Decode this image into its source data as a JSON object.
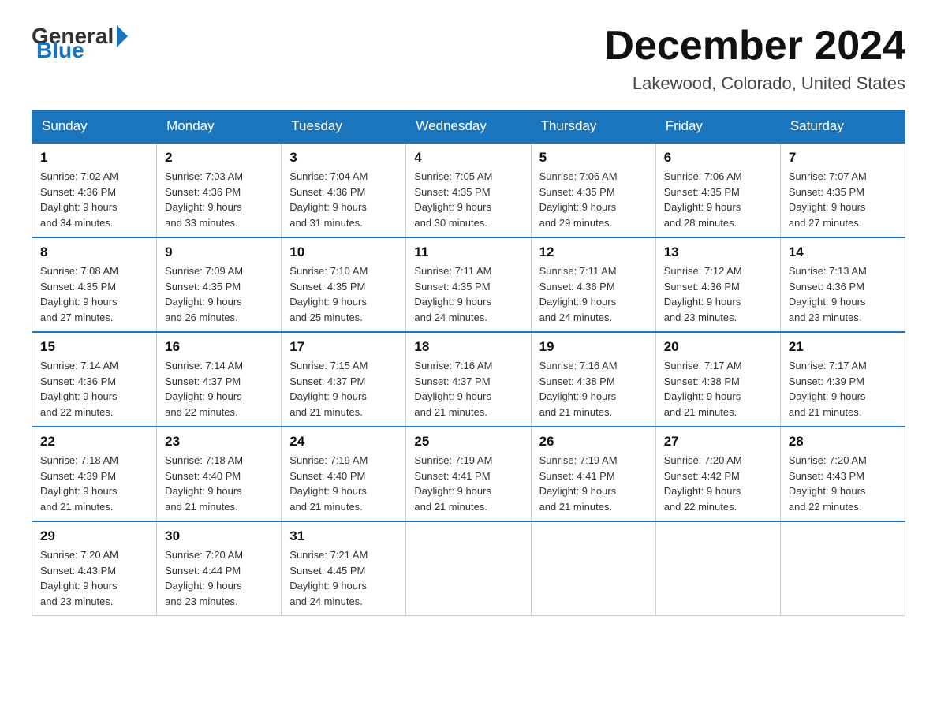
{
  "header": {
    "logo_general": "General",
    "logo_blue": "Blue",
    "month_title": "December 2024",
    "location": "Lakewood, Colorado, United States"
  },
  "weekdays": [
    "Sunday",
    "Monday",
    "Tuesday",
    "Wednesday",
    "Thursday",
    "Friday",
    "Saturday"
  ],
  "weeks": [
    [
      {
        "day": "1",
        "sunrise": "7:02 AM",
        "sunset": "4:36 PM",
        "daylight": "9 hours and 34 minutes."
      },
      {
        "day": "2",
        "sunrise": "7:03 AM",
        "sunset": "4:36 PM",
        "daylight": "9 hours and 33 minutes."
      },
      {
        "day": "3",
        "sunrise": "7:04 AM",
        "sunset": "4:36 PM",
        "daylight": "9 hours and 31 minutes."
      },
      {
        "day": "4",
        "sunrise": "7:05 AM",
        "sunset": "4:35 PM",
        "daylight": "9 hours and 30 minutes."
      },
      {
        "day": "5",
        "sunrise": "7:06 AM",
        "sunset": "4:35 PM",
        "daylight": "9 hours and 29 minutes."
      },
      {
        "day": "6",
        "sunrise": "7:06 AM",
        "sunset": "4:35 PM",
        "daylight": "9 hours and 28 minutes."
      },
      {
        "day": "7",
        "sunrise": "7:07 AM",
        "sunset": "4:35 PM",
        "daylight": "9 hours and 27 minutes."
      }
    ],
    [
      {
        "day": "8",
        "sunrise": "7:08 AM",
        "sunset": "4:35 PM",
        "daylight": "9 hours and 27 minutes."
      },
      {
        "day": "9",
        "sunrise": "7:09 AM",
        "sunset": "4:35 PM",
        "daylight": "9 hours and 26 minutes."
      },
      {
        "day": "10",
        "sunrise": "7:10 AM",
        "sunset": "4:35 PM",
        "daylight": "9 hours and 25 minutes."
      },
      {
        "day": "11",
        "sunrise": "7:11 AM",
        "sunset": "4:35 PM",
        "daylight": "9 hours and 24 minutes."
      },
      {
        "day": "12",
        "sunrise": "7:11 AM",
        "sunset": "4:36 PM",
        "daylight": "9 hours and 24 minutes."
      },
      {
        "day": "13",
        "sunrise": "7:12 AM",
        "sunset": "4:36 PM",
        "daylight": "9 hours and 23 minutes."
      },
      {
        "day": "14",
        "sunrise": "7:13 AM",
        "sunset": "4:36 PM",
        "daylight": "9 hours and 23 minutes."
      }
    ],
    [
      {
        "day": "15",
        "sunrise": "7:14 AM",
        "sunset": "4:36 PM",
        "daylight": "9 hours and 22 minutes."
      },
      {
        "day": "16",
        "sunrise": "7:14 AM",
        "sunset": "4:37 PM",
        "daylight": "9 hours and 22 minutes."
      },
      {
        "day": "17",
        "sunrise": "7:15 AM",
        "sunset": "4:37 PM",
        "daylight": "9 hours and 21 minutes."
      },
      {
        "day": "18",
        "sunrise": "7:16 AM",
        "sunset": "4:37 PM",
        "daylight": "9 hours and 21 minutes."
      },
      {
        "day": "19",
        "sunrise": "7:16 AM",
        "sunset": "4:38 PM",
        "daylight": "9 hours and 21 minutes."
      },
      {
        "day": "20",
        "sunrise": "7:17 AM",
        "sunset": "4:38 PM",
        "daylight": "9 hours and 21 minutes."
      },
      {
        "day": "21",
        "sunrise": "7:17 AM",
        "sunset": "4:39 PM",
        "daylight": "9 hours and 21 minutes."
      }
    ],
    [
      {
        "day": "22",
        "sunrise": "7:18 AM",
        "sunset": "4:39 PM",
        "daylight": "9 hours and 21 minutes."
      },
      {
        "day": "23",
        "sunrise": "7:18 AM",
        "sunset": "4:40 PM",
        "daylight": "9 hours and 21 minutes."
      },
      {
        "day": "24",
        "sunrise": "7:19 AM",
        "sunset": "4:40 PM",
        "daylight": "9 hours and 21 minutes."
      },
      {
        "day": "25",
        "sunrise": "7:19 AM",
        "sunset": "4:41 PM",
        "daylight": "9 hours and 21 minutes."
      },
      {
        "day": "26",
        "sunrise": "7:19 AM",
        "sunset": "4:41 PM",
        "daylight": "9 hours and 21 minutes."
      },
      {
        "day": "27",
        "sunrise": "7:20 AM",
        "sunset": "4:42 PM",
        "daylight": "9 hours and 22 minutes."
      },
      {
        "day": "28",
        "sunrise": "7:20 AM",
        "sunset": "4:43 PM",
        "daylight": "9 hours and 22 minutes."
      }
    ],
    [
      {
        "day": "29",
        "sunrise": "7:20 AM",
        "sunset": "4:43 PM",
        "daylight": "9 hours and 23 minutes."
      },
      {
        "day": "30",
        "sunrise": "7:20 AM",
        "sunset": "4:44 PM",
        "daylight": "9 hours and 23 minutes."
      },
      {
        "day": "31",
        "sunrise": "7:21 AM",
        "sunset": "4:45 PM",
        "daylight": "9 hours and 24 minutes."
      },
      null,
      null,
      null,
      null
    ]
  ],
  "labels": {
    "sunrise": "Sunrise:",
    "sunset": "Sunset:",
    "daylight": "Daylight:"
  }
}
